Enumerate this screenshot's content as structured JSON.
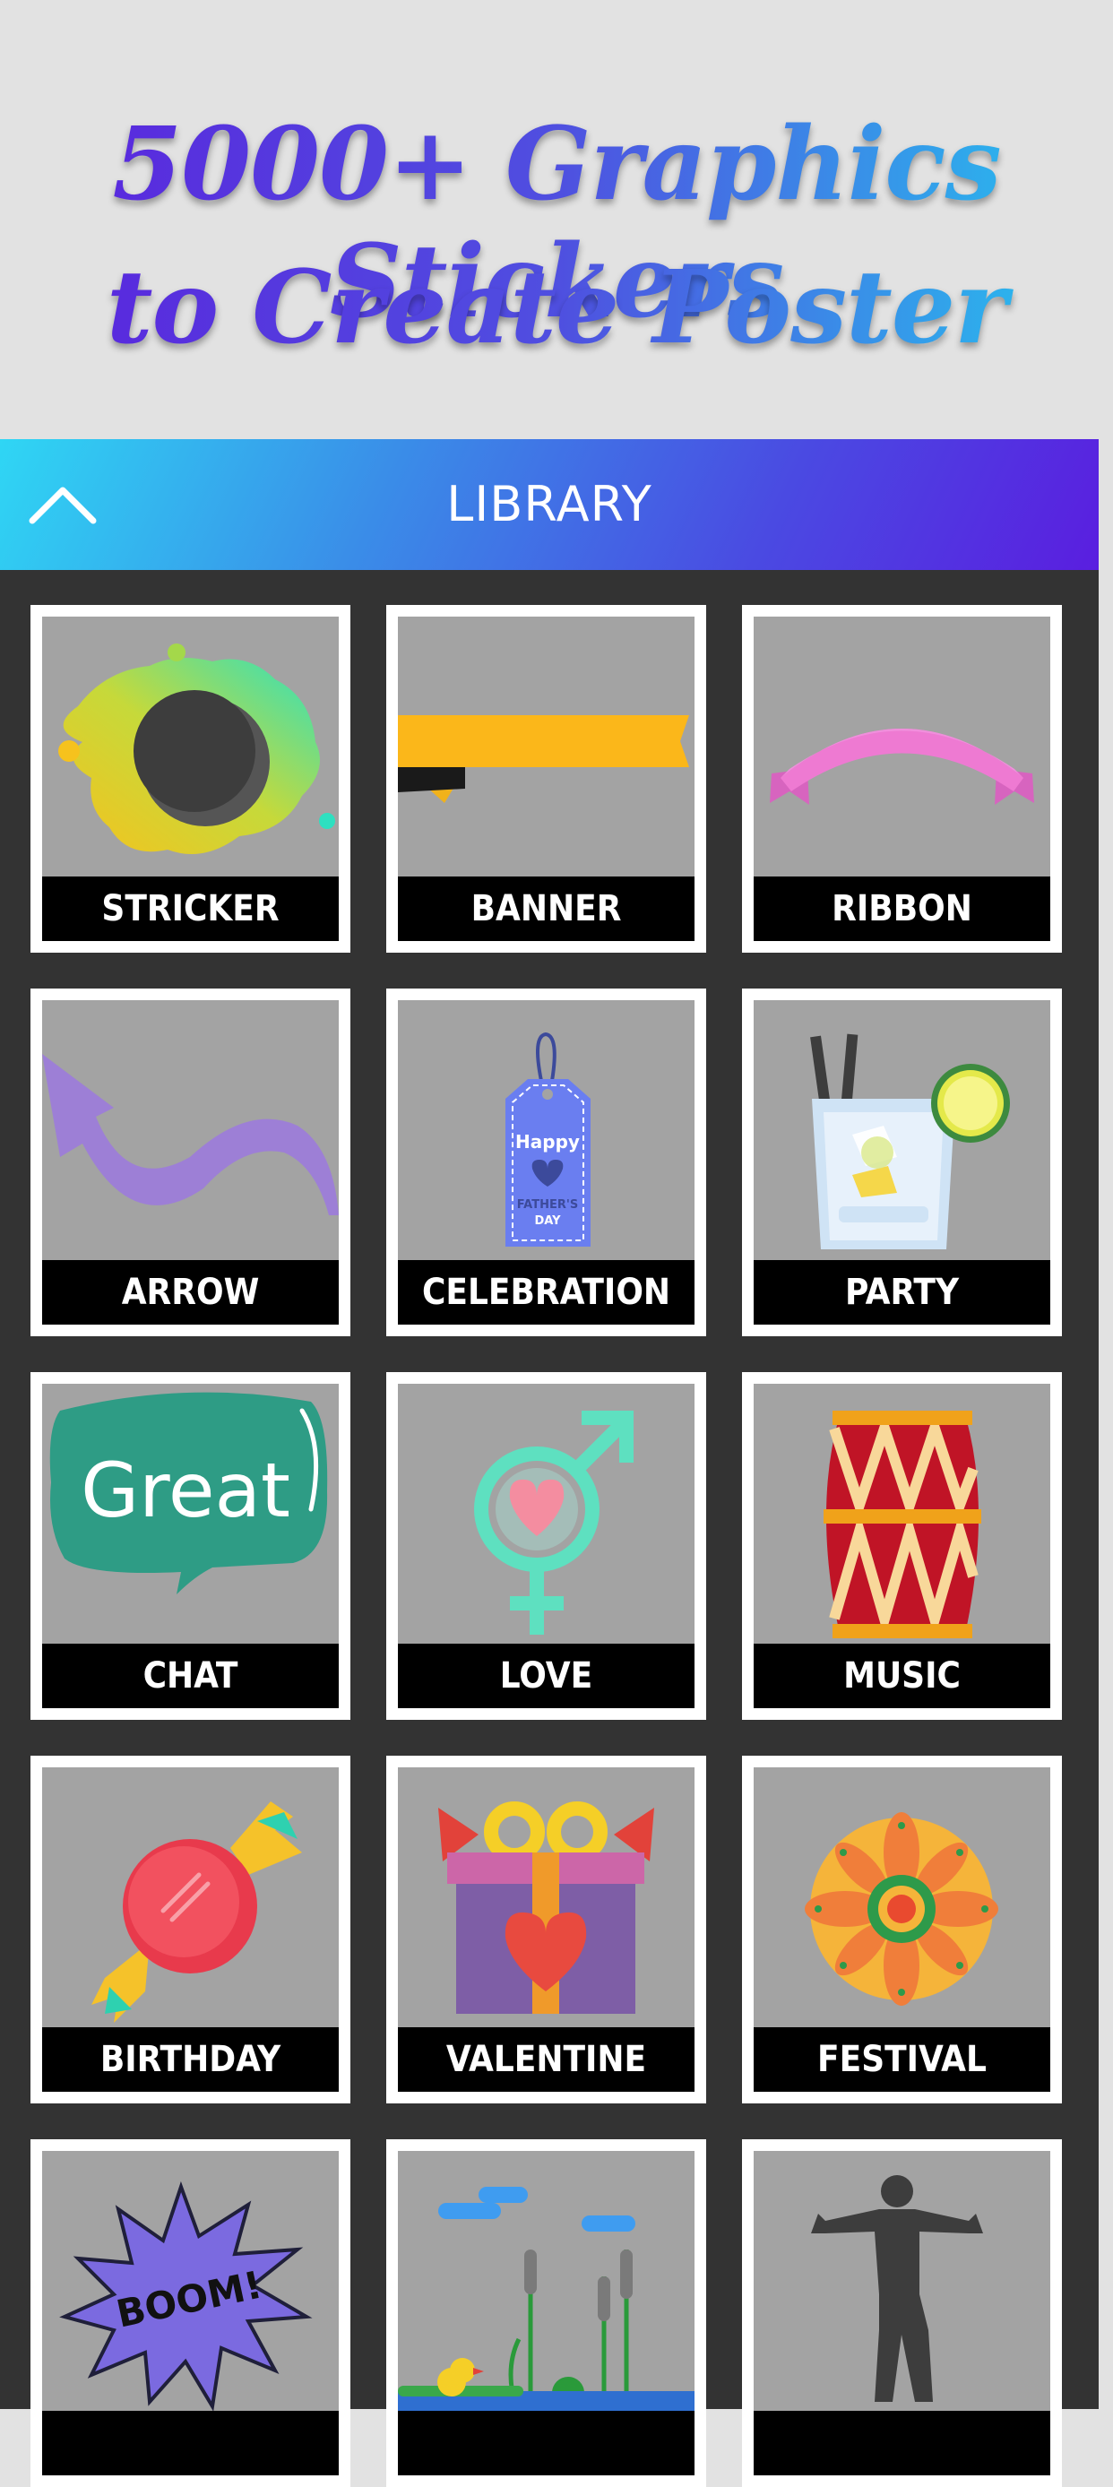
{
  "promo": {
    "line1": "5000+ Graphics Stickers",
    "line2": "to Create Poster"
  },
  "library": {
    "title": "LIBRARY",
    "collapse_icon": "chevron-up-icon",
    "categories": [
      {
        "label": "STRICKER",
        "icon": "paint-splash-circle-icon"
      },
      {
        "label": "BANNER",
        "icon": "banner-ribbon-icon"
      },
      {
        "label": "RIBBON",
        "icon": "curved-ribbon-icon"
      },
      {
        "label": "ARROW",
        "icon": "curved-arrow-icon"
      },
      {
        "label": "CELEBRATION",
        "icon": "gift-tag-icon",
        "art_text_1": "Happy",
        "art_text_2": "FATHER'S",
        "art_text_3": "DAY"
      },
      {
        "label": "PARTY",
        "icon": "cocktail-glass-icon"
      },
      {
        "label": "CHAT",
        "icon": "speech-bubble-icon",
        "art_text": "Great"
      },
      {
        "label": "LOVE",
        "icon": "gender-heart-icon"
      },
      {
        "label": "MUSIC",
        "icon": "dhol-drum-icon"
      },
      {
        "label": "BIRTHDAY",
        "icon": "candy-icon"
      },
      {
        "label": "VALENTINE",
        "icon": "gift-box-heart-icon"
      },
      {
        "label": "FESTIVAL",
        "icon": "rangoli-flower-icon"
      },
      {
        "label": "",
        "icon": "boom-burst-icon",
        "art_text": "BOOM!"
      },
      {
        "label": "",
        "icon": "pond-landscape-icon"
      },
      {
        "label": "",
        "icon": "fitness-man-icon"
      }
    ]
  },
  "colors": {
    "header_gradient_start": "#2fd6f4",
    "header_gradient_end": "#5a1ee0",
    "panel_background": "#333333",
    "card_background": "#a3a3a3",
    "label_background": "#000000"
  }
}
